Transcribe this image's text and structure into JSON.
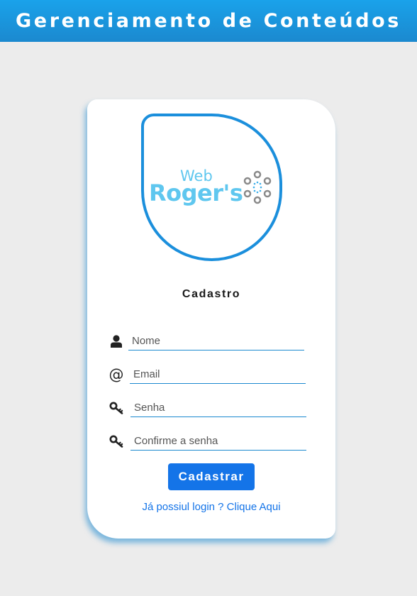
{
  "header": {
    "title": "Gerenciamento de Conteúdos"
  },
  "logo": {
    "web": "Web",
    "name": "Roger's"
  },
  "form": {
    "title": "Cadastro",
    "fields": [
      {
        "icon": "user-icon",
        "placeholder": "Nome",
        "value": ""
      },
      {
        "icon": "at-icon",
        "glyph": "@",
        "placeholder": "Email",
        "value": ""
      },
      {
        "icon": "key-icon",
        "placeholder": "Senha",
        "value": ""
      },
      {
        "icon": "key-icon",
        "placeholder": "Confirme a senha",
        "value": ""
      }
    ],
    "submit_label": "Cadastrar",
    "login_link": "Já possiul login ? Clique Aqui"
  },
  "colors": {
    "header": "#1b89cf",
    "primary": "#1474e8",
    "logo_text": "#5fc7ef",
    "logo_frame": "#1b8fdc",
    "background": "#ececec"
  }
}
